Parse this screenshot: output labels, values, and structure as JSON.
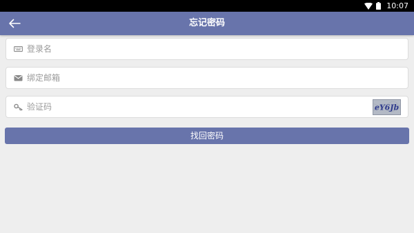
{
  "status_bar": {
    "time": "10:07",
    "icons": [
      "wifi-icon",
      "battery-icon"
    ]
  },
  "app_bar": {
    "title": "忘记密码",
    "back_icon": "arrow-left-icon"
  },
  "form": {
    "username": {
      "icon": "keyboard-icon",
      "placeholder": "登录名",
      "value": ""
    },
    "email": {
      "icon": "envelope-icon",
      "placeholder": "绑定邮箱",
      "value": ""
    },
    "captcha": {
      "icon": "key-icon",
      "placeholder": "验证码",
      "value": "",
      "image_text": "eY6Jb"
    },
    "submit_label": "找回密码"
  },
  "colors": {
    "primary": "#6874ab",
    "background": "#eeeeee",
    "status_bar": "#000000",
    "icon_gray": "#8a8a8a",
    "placeholder": "#9a9a9a"
  }
}
